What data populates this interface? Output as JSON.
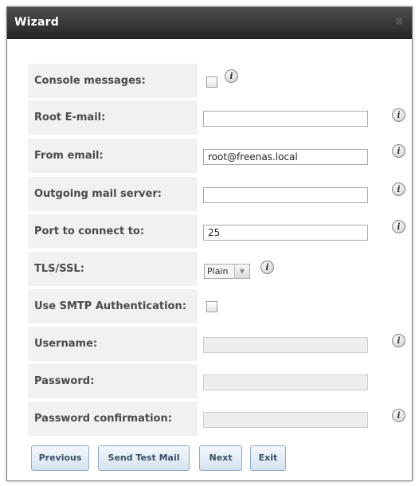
{
  "dialog": {
    "title": "Wizard",
    "close_glyph": "⊠"
  },
  "form": {
    "console_messages": {
      "label": "Console messages:",
      "checked": false
    },
    "root_email": {
      "label": "Root E-mail:",
      "value": ""
    },
    "from_email": {
      "label": "From email:",
      "value": "root@freenas.local"
    },
    "outgoing_mail_server": {
      "label": "Outgoing mail server:",
      "value": ""
    },
    "port": {
      "label": "Port to connect to:",
      "value": "25"
    },
    "tls_ssl": {
      "label": "TLS/SSL:",
      "selected": "Plain"
    },
    "use_smtp_auth": {
      "label": "Use SMTP Authentication:",
      "checked": false
    },
    "username": {
      "label": "Username:",
      "value": ""
    },
    "password": {
      "label": "Password:",
      "value": ""
    },
    "password_confirmation": {
      "label": "Password confirmation:",
      "value": ""
    }
  },
  "buttons": {
    "previous": "Previous",
    "send_test_mail": "Send Test Mail",
    "next": "Next",
    "exit": "Exit"
  },
  "icons": {
    "info": "info-icon",
    "close": "close-icon",
    "dropdown": "chevron-down-icon"
  },
  "colors": {
    "titlebar": "#333333",
    "label_bg": "#f1f1f1",
    "button_border": "#8ea9c6"
  }
}
